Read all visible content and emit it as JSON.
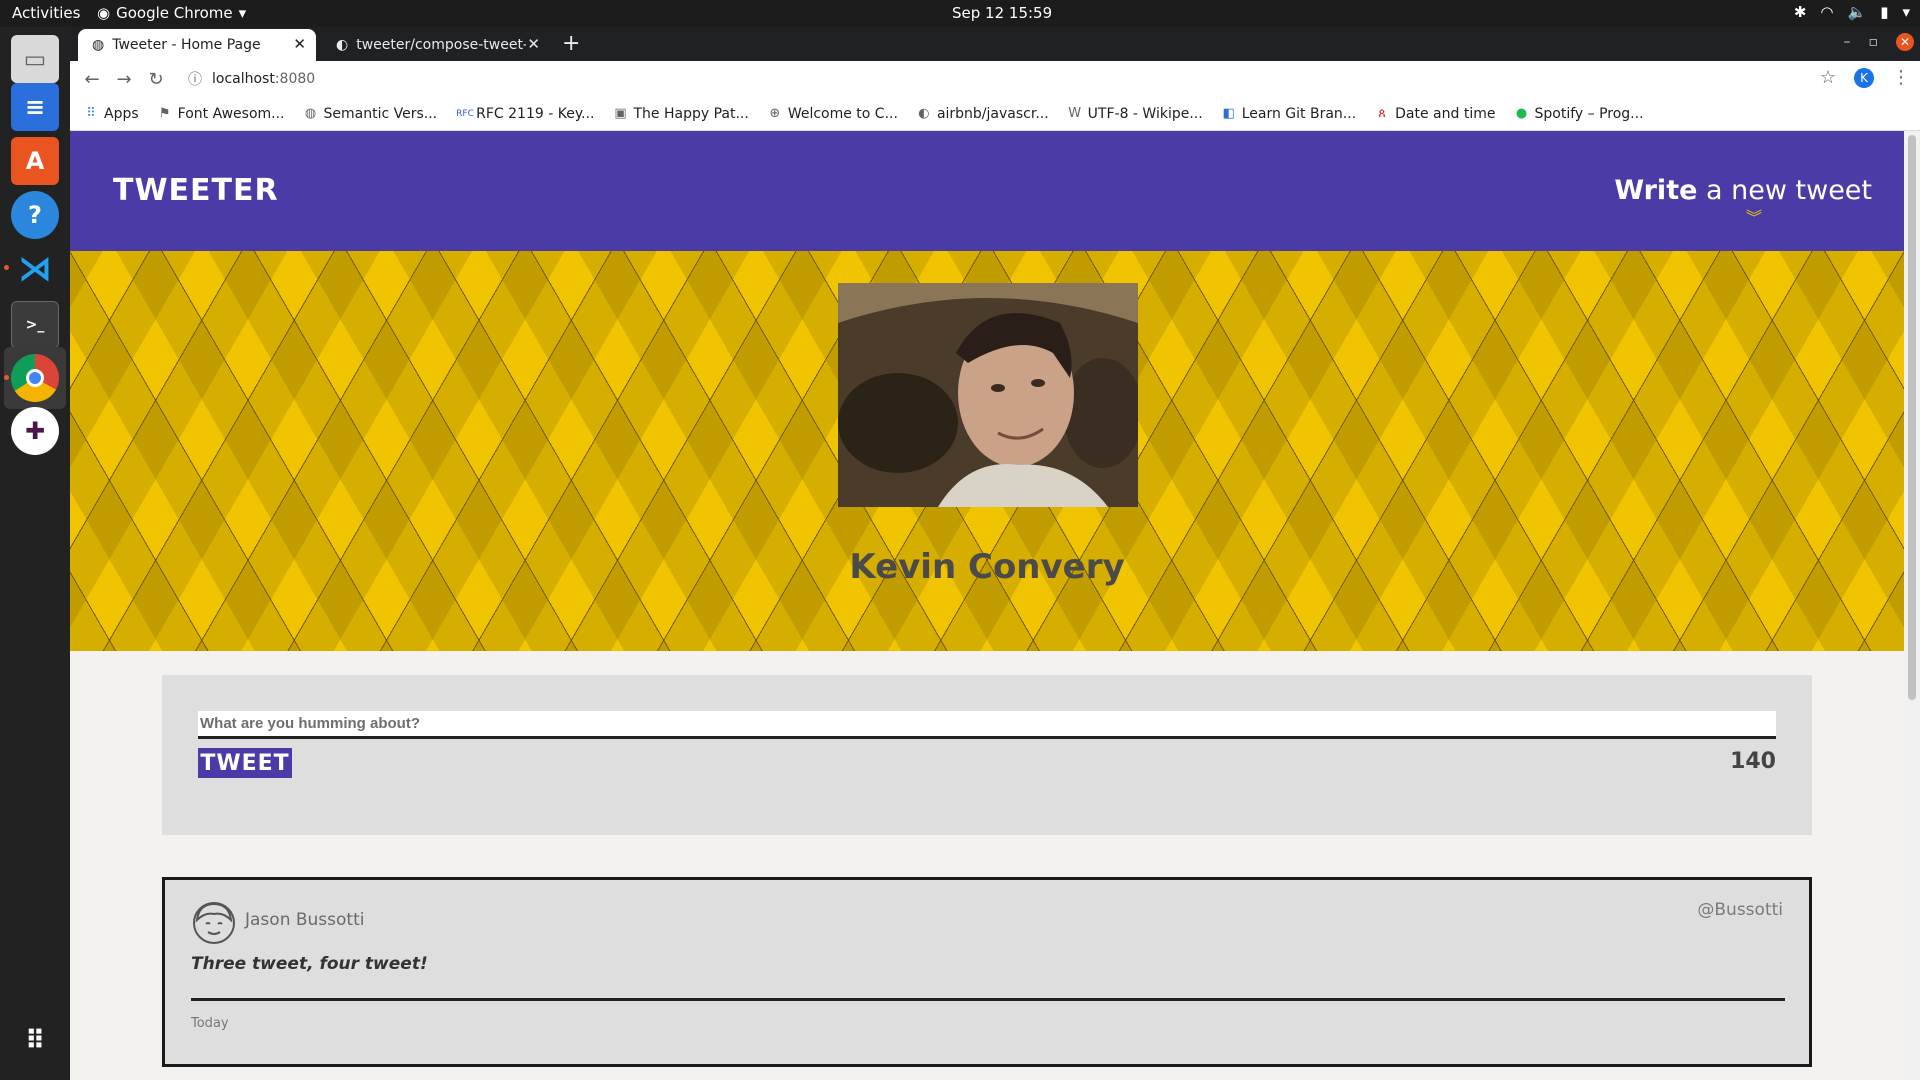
{
  "system": {
    "activities": "Activities",
    "app_menu": "Google Chrome",
    "clock": "Sep 12  15:59"
  },
  "browser": {
    "tabs": [
      {
        "title": "Tweeter - Home Page",
        "active": true
      },
      {
        "title": "tweeter/compose-tweet-",
        "active": false
      }
    ],
    "url_host": "localhost",
    "url_port": ":8080",
    "profile_initial": "K",
    "bookmarks": [
      {
        "label": "Apps",
        "icon": "apps-grid-icon"
      },
      {
        "label": "Font Awesom...",
        "icon": "flag-icon"
      },
      {
        "label": "Semantic Vers...",
        "icon": "globe-icon"
      },
      {
        "label": "RFC 2119 - Key...",
        "icon": "rfc-icon"
      },
      {
        "label": "The Happy Pat...",
        "icon": "page-icon"
      },
      {
        "label": "Welcome to C...",
        "icon": "compass-icon"
      },
      {
        "label": "airbnb/javascr...",
        "icon": "github-icon"
      },
      {
        "label": "UTF-8 - Wikipe...",
        "icon": "wikipedia-icon"
      },
      {
        "label": "Learn Git Bran...",
        "icon": "git-icon"
      },
      {
        "label": "Date and time",
        "icon": "figure-icon"
      },
      {
        "label": "Spotify – Prog...",
        "icon": "spotify-icon"
      }
    ]
  },
  "site": {
    "logo": "TWEETER",
    "compose_bold": "Write",
    "compose_rest": " a new tweet",
    "colors": {
      "nav": "#4b3ba6",
      "accent": "#f0c400"
    }
  },
  "profile": {
    "name": "Kevin Convery"
  },
  "composer": {
    "placeholder": "What are you humming about?",
    "button_label": "TWEET",
    "counter": "140"
  },
  "tweets": [
    {
      "author": "Jason Bussotti",
      "handle": "@Bussotti",
      "content": "Three tweet, four tweet!",
      "time": "Today"
    }
  ]
}
